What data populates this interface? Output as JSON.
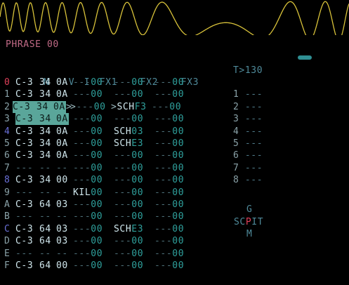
{
  "waveform": {
    "color": "#d8c23a"
  },
  "phrase": {
    "title": "PHRASE 00"
  },
  "columns": {
    "n": "N",
    "v": "V",
    "i": "I",
    "fx1": "FX1",
    "fx2": "FX2",
    "fx3": "FX3"
  },
  "tempo": "T>130",
  "rows": [
    {
      "idx": "0",
      "note": "C-3",
      "vol": "34",
      "ins": "0A",
      "fx1": "---00",
      "fx2": "---00",
      "fx3": "---00"
    },
    {
      "idx": "1",
      "note": "C-3",
      "vol": "34",
      "ins": "0A",
      "fx1": "---00",
      "fx2": "---00",
      "fx3": "---00"
    },
    {
      "idx": "2",
      "note": "C-3",
      "vol": "34",
      "ins": "0A",
      "fx1": "---00",
      "fx2": "SCHF3",
      "fx3": "---00"
    },
    {
      "idx": "3",
      "note": "C-3",
      "vol": "34",
      "ins": "0A",
      "fx1": "---00",
      "fx2": "---00",
      "fx3": "---00"
    },
    {
      "idx": "4",
      "note": "C-3",
      "vol": "34",
      "ins": "0A",
      "fx1": "---00",
      "fx2": "SCH03",
      "fx3": "---00"
    },
    {
      "idx": "5",
      "note": "C-3",
      "vol": "34",
      "ins": "0A",
      "fx1": "---00",
      "fx2": "SCHE3",
      "fx3": "---00"
    },
    {
      "idx": "6",
      "note": "C-3",
      "vol": "34",
      "ins": "0A",
      "fx1": "---00",
      "fx2": "---00",
      "fx3": "---00"
    },
    {
      "idx": "7",
      "note": "---",
      "vol": "--",
      "ins": "--",
      "fx1": "---00",
      "fx2": "---00",
      "fx3": "---00"
    },
    {
      "idx": "8",
      "note": "C-3",
      "vol": "34",
      "ins": "00",
      "fx1": "---00",
      "fx2": "---00",
      "fx3": "---00"
    },
    {
      "idx": "9",
      "note": "---",
      "vol": "--",
      "ins": "--",
      "fx1": "KIL00",
      "fx2": "---00",
      "fx3": "---00"
    },
    {
      "idx": "A",
      "note": "C-3",
      "vol": "64",
      "ins": "03",
      "fx1": "---00",
      "fx2": "---00",
      "fx3": "---00"
    },
    {
      "idx": "B",
      "note": "---",
      "vol": "--",
      "ins": "--",
      "fx1": "---00",
      "fx2": "---00",
      "fx3": "---00"
    },
    {
      "idx": "C",
      "note": "C-3",
      "vol": "64",
      "ins": "03",
      "fx1": "---00",
      "fx2": "SCHE3",
      "fx3": "---00"
    },
    {
      "idx": "D",
      "note": "C-3",
      "vol": "64",
      "ins": "03",
      "fx1": "---00",
      "fx2": "---00",
      "fx3": "---00"
    },
    {
      "idx": "E",
      "note": "---",
      "vol": "--",
      "ins": "--",
      "fx1": "---00",
      "fx2": "---00",
      "fx3": "---00"
    },
    {
      "idx": "F",
      "note": "C-3",
      "vol": "64",
      "ins": "00",
      "fx1": "---00",
      "fx2": "---00",
      "fx3": "---00"
    }
  ],
  "tables": [
    {
      "num": "1",
      "val": "---"
    },
    {
      "num": "2",
      "val": "---"
    },
    {
      "num": "3",
      "val": "---"
    },
    {
      "num": "4",
      "val": "---"
    },
    {
      "num": "5",
      "val": "---"
    },
    {
      "num": "6",
      "val": "---"
    },
    {
      "num": "7",
      "val": "---"
    },
    {
      "num": "8",
      "val": "---"
    }
  ],
  "side": {
    "g": "G",
    "sc": "SC",
    "p": "P",
    "it": "IT",
    "m": "M"
  }
}
